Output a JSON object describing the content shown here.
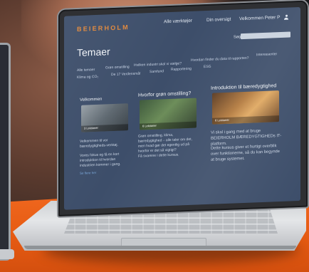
{
  "site": {
    "logo": "BEIERHOLM",
    "nav": {
      "item1": "Alle værktøjer",
      "item2": "Din oversigt",
      "item3": "Velkommen Peter P"
    },
    "search_label": "Søg",
    "search_placeholder": ""
  },
  "page": {
    "title": "Temaer",
    "topics": [
      "Alle temaer",
      "Grøn omstilling",
      "Hvilken industri skal vi vælge?",
      "Hvordan finder du data til rapporten?",
      "Interessenter",
      "Klima og CO₂",
      "De 17 Verdensmål",
      "Samfund",
      "Rapportering",
      "ESG"
    ],
    "columns": [
      {
        "title": "Velkommen",
        "tag": "3 Lektioner",
        "text": "Velkommen til vor bæredygtigheds-verktøj.",
        "text2": "Vores fokus og få en kort introduktion til hvordan industrien kommer i gang.",
        "link": "Se flere her"
      },
      {
        "title": "Hvorfor grøn omstilling?",
        "tag": "6 Lektioner",
        "text": "Grøn omstilling, klima, bæredygtighed – alle taler om det, men hvad gør det egentlig ud på hvorfor er det så vigtigt?",
        "text2": "Få svarene i dette kursus."
      },
      {
        "title": "Introduktion til bæredygtighed",
        "tag": "6 Lektioner",
        "text": "Vi skal i gang med at bruge BEIERHOLM BÆREDYGTIGHEDs IT-platform.",
        "text2": "Dette kursus giver et hurtigt overblik over funktionerne, så du kan begynde at bruge systemet."
      }
    ]
  },
  "colors": {
    "screen_bg": "#3d4e6a",
    "logo": "#e0873a",
    "orange_backdrop": "#f26a21"
  }
}
